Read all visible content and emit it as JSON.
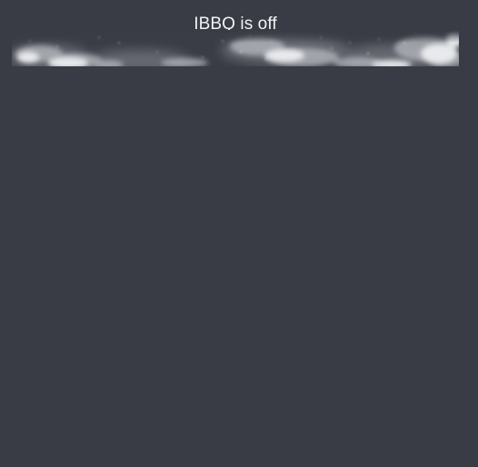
{
  "status": {
    "title": "IBBQ is off"
  },
  "banner": {
    "image": "smoke-cloud-banner",
    "color_background": "#393c45",
    "color_smoke": "#d9dbe0"
  }
}
